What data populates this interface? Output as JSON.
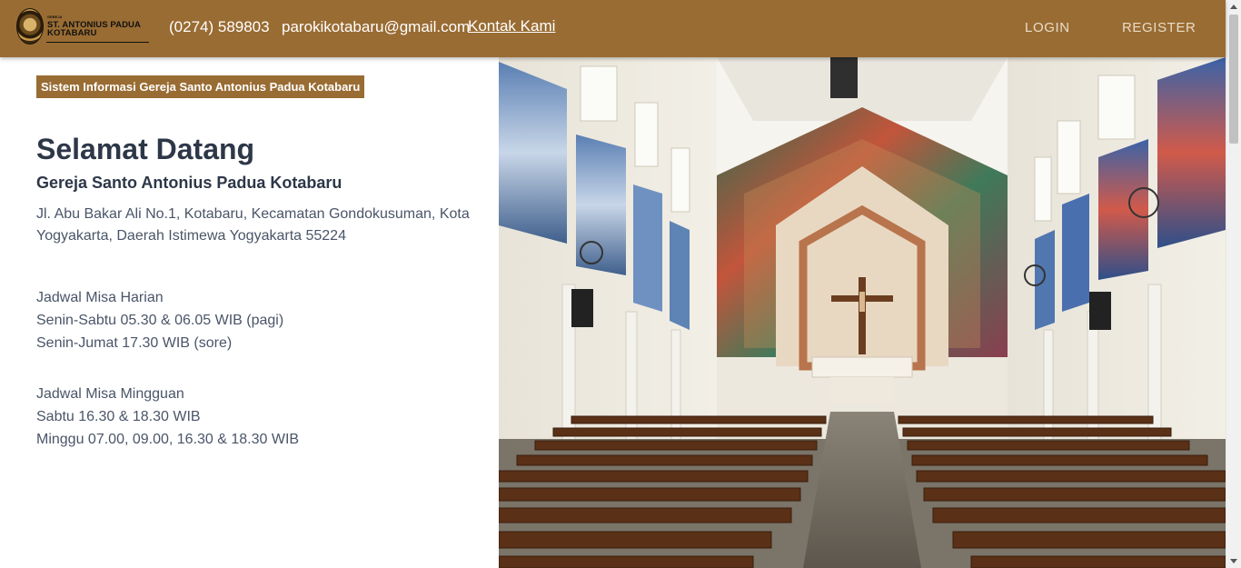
{
  "header": {
    "logo_small": "GEREJA",
    "logo_line1": "ST. ANTONIUS PADUA",
    "logo_line2": "KOTABARU",
    "phone": "(0274) 589803",
    "email": "parokikotabaru@gmail.com",
    "contact_link": "Kontak Kami",
    "login": "LOGIN",
    "register": "REGISTER"
  },
  "main": {
    "badge": "Sistem Informasi Gereja Santo Antonius Padua Kotabaru",
    "welcome": "Selamat Datang",
    "church_name": "Gereja Santo Antonius Padua Kotabaru",
    "address": "Jl. Abu Bakar Ali No.1, Kotabaru, Kecamatan Gondokusuman, Kota Yogyakarta, Daerah Istimewa Yogyakarta 55224",
    "daily_mass": {
      "title": "Jadwal Misa Harian",
      "lines": [
        "Senin-Sabtu 05.30 & 06.05 WIB (pagi)",
        "Senin-Jumat 17.30 WIB (sore)"
      ]
    },
    "weekly_mass": {
      "title": "Jadwal Misa Mingguan",
      "lines": [
        "Sabtu 16.30 & 18.30 WIB",
        "Minggu 07.00, 09.00, 16.30 & 18.30 WIB"
      ]
    }
  },
  "colors": {
    "brand": "#996c33",
    "text_dark": "#2d3748",
    "text_body": "#4a5568"
  }
}
